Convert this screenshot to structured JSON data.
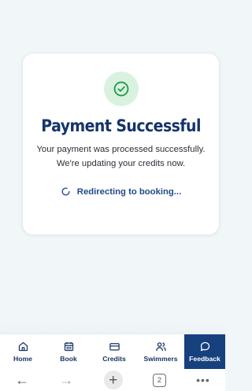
{
  "card": {
    "title": "Payment Successful",
    "message": "Your payment was processed successfully. We're updating your credits now.",
    "redirect_text": "Redirecting to booking..."
  },
  "nav": {
    "items": [
      {
        "label": "Home",
        "icon": "home-icon"
      },
      {
        "label": "Book",
        "icon": "calendar-icon"
      },
      {
        "label": "Credits",
        "icon": "credit-card-icon"
      },
      {
        "label": "Swimmers",
        "icon": "users-icon"
      },
      {
        "label": "Feedback",
        "icon": "chat-bubble-icon"
      }
    ]
  },
  "browser": {
    "tab_count": "2"
  },
  "colors": {
    "background": "#f1f7f8",
    "brand_navy": "#15346a",
    "success_green": "#1e9a4a",
    "success_bg": "#d9f2e0",
    "feedback_bg": "#17407e"
  }
}
